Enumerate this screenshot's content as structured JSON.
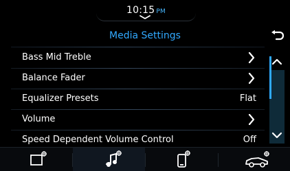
{
  "status": {
    "time": "10:15",
    "ampm": "PM"
  },
  "header": {
    "title": "Media Settings"
  },
  "settings": {
    "items": [
      {
        "label": "Bass Mid Treble",
        "value": "",
        "type": "submenu"
      },
      {
        "label": "Balance Fader",
        "value": "",
        "type": "submenu"
      },
      {
        "label": "Equalizer Presets",
        "value": "Flat",
        "type": "value"
      },
      {
        "label": "Volume",
        "value": "",
        "type": "submenu"
      },
      {
        "label": "Speed Dependent Volume Control",
        "value": "Off",
        "type": "value"
      }
    ]
  },
  "scroll": {
    "up_icon": "chevron-up-icon",
    "down_icon": "chevron-down-icon",
    "visible_fraction": 0.5
  },
  "bottom_tabs": [
    {
      "icon": "display-settings-icon",
      "active": false
    },
    {
      "icon": "audio-settings-icon",
      "active": true
    },
    {
      "icon": "phone-settings-icon",
      "active": false
    },
    {
      "icon": "vehicle-settings-icon",
      "active": false
    }
  ],
  "colors": {
    "accent": "#31a9ff",
    "background": "#000000",
    "text": "#ffffff"
  }
}
